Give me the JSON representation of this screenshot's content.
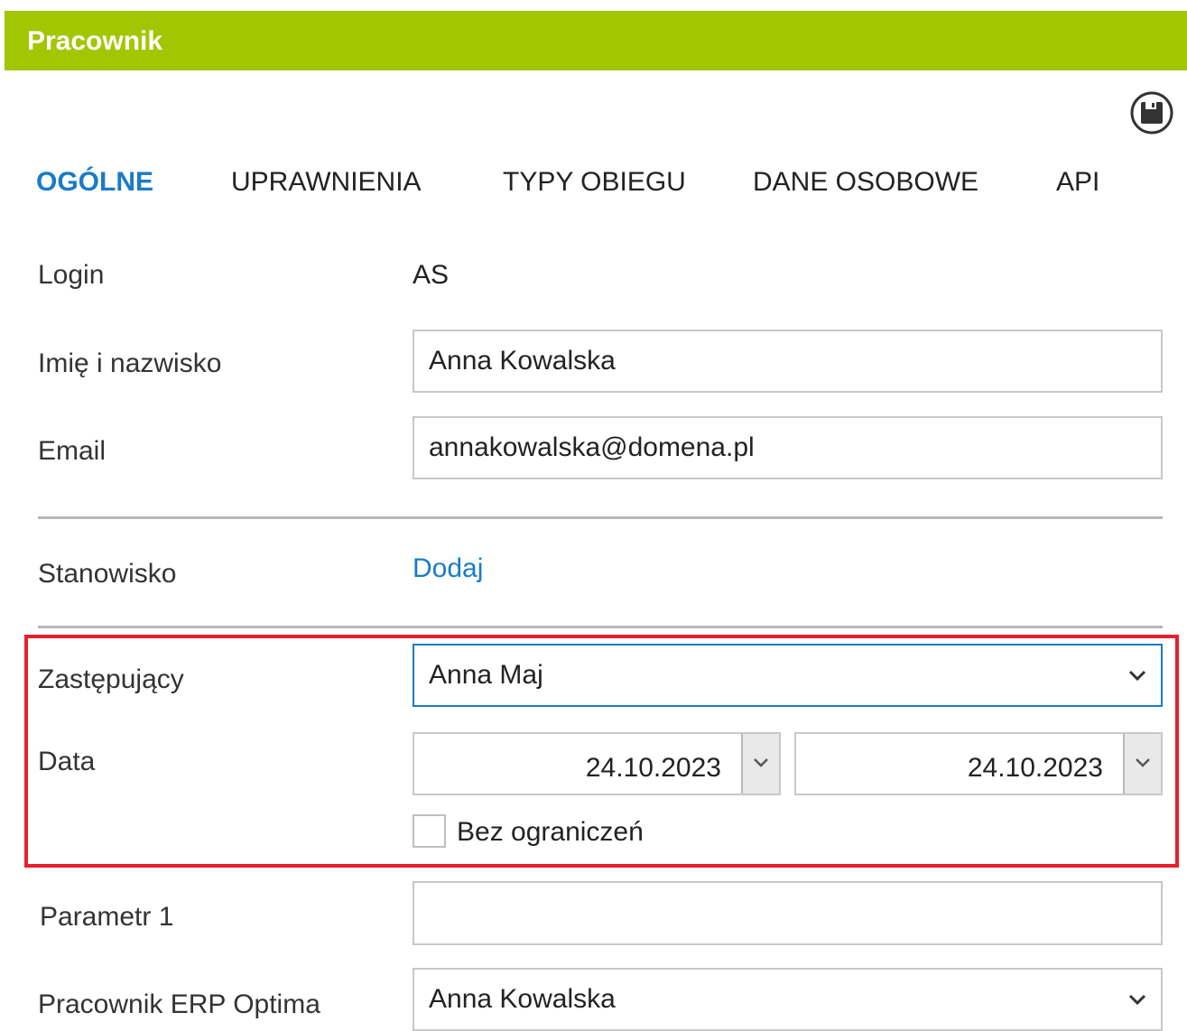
{
  "header": {
    "title": "Pracownik"
  },
  "toolbar": {
    "save_icon": "save-icon"
  },
  "tabs": [
    {
      "label": "OGÓLNE",
      "active": true
    },
    {
      "label": "UPRAWNIENIA",
      "active": false
    },
    {
      "label": "TYPY OBIEGU",
      "active": false
    },
    {
      "label": "DANE OSOBOWE",
      "active": false
    },
    {
      "label": "API",
      "active": false
    }
  ],
  "form": {
    "login": {
      "label": "Login",
      "value": "AS"
    },
    "name": {
      "label": "Imię i nazwisko",
      "value": "Anna Kowalska"
    },
    "email": {
      "label": "Email",
      "value": "annakowalska@domena.pl"
    },
    "position": {
      "label": "Stanowisko",
      "link": "Dodaj"
    },
    "substitute": {
      "label": "Zastępujący",
      "value": "Anna Maj"
    },
    "date": {
      "label": "Data",
      "from": "24.10.2023",
      "to": "24.10.2023"
    },
    "no_limit": {
      "label": "Bez ograniczeń",
      "checked": false
    },
    "param1": {
      "label": "Parametr 1",
      "value": ""
    },
    "erp": {
      "label": "Pracownik ERP Optima",
      "value": "Anna Kowalska"
    }
  },
  "colors": {
    "header": "#a3c600",
    "accent": "#1a7bc8",
    "highlight": "#e8202e"
  }
}
